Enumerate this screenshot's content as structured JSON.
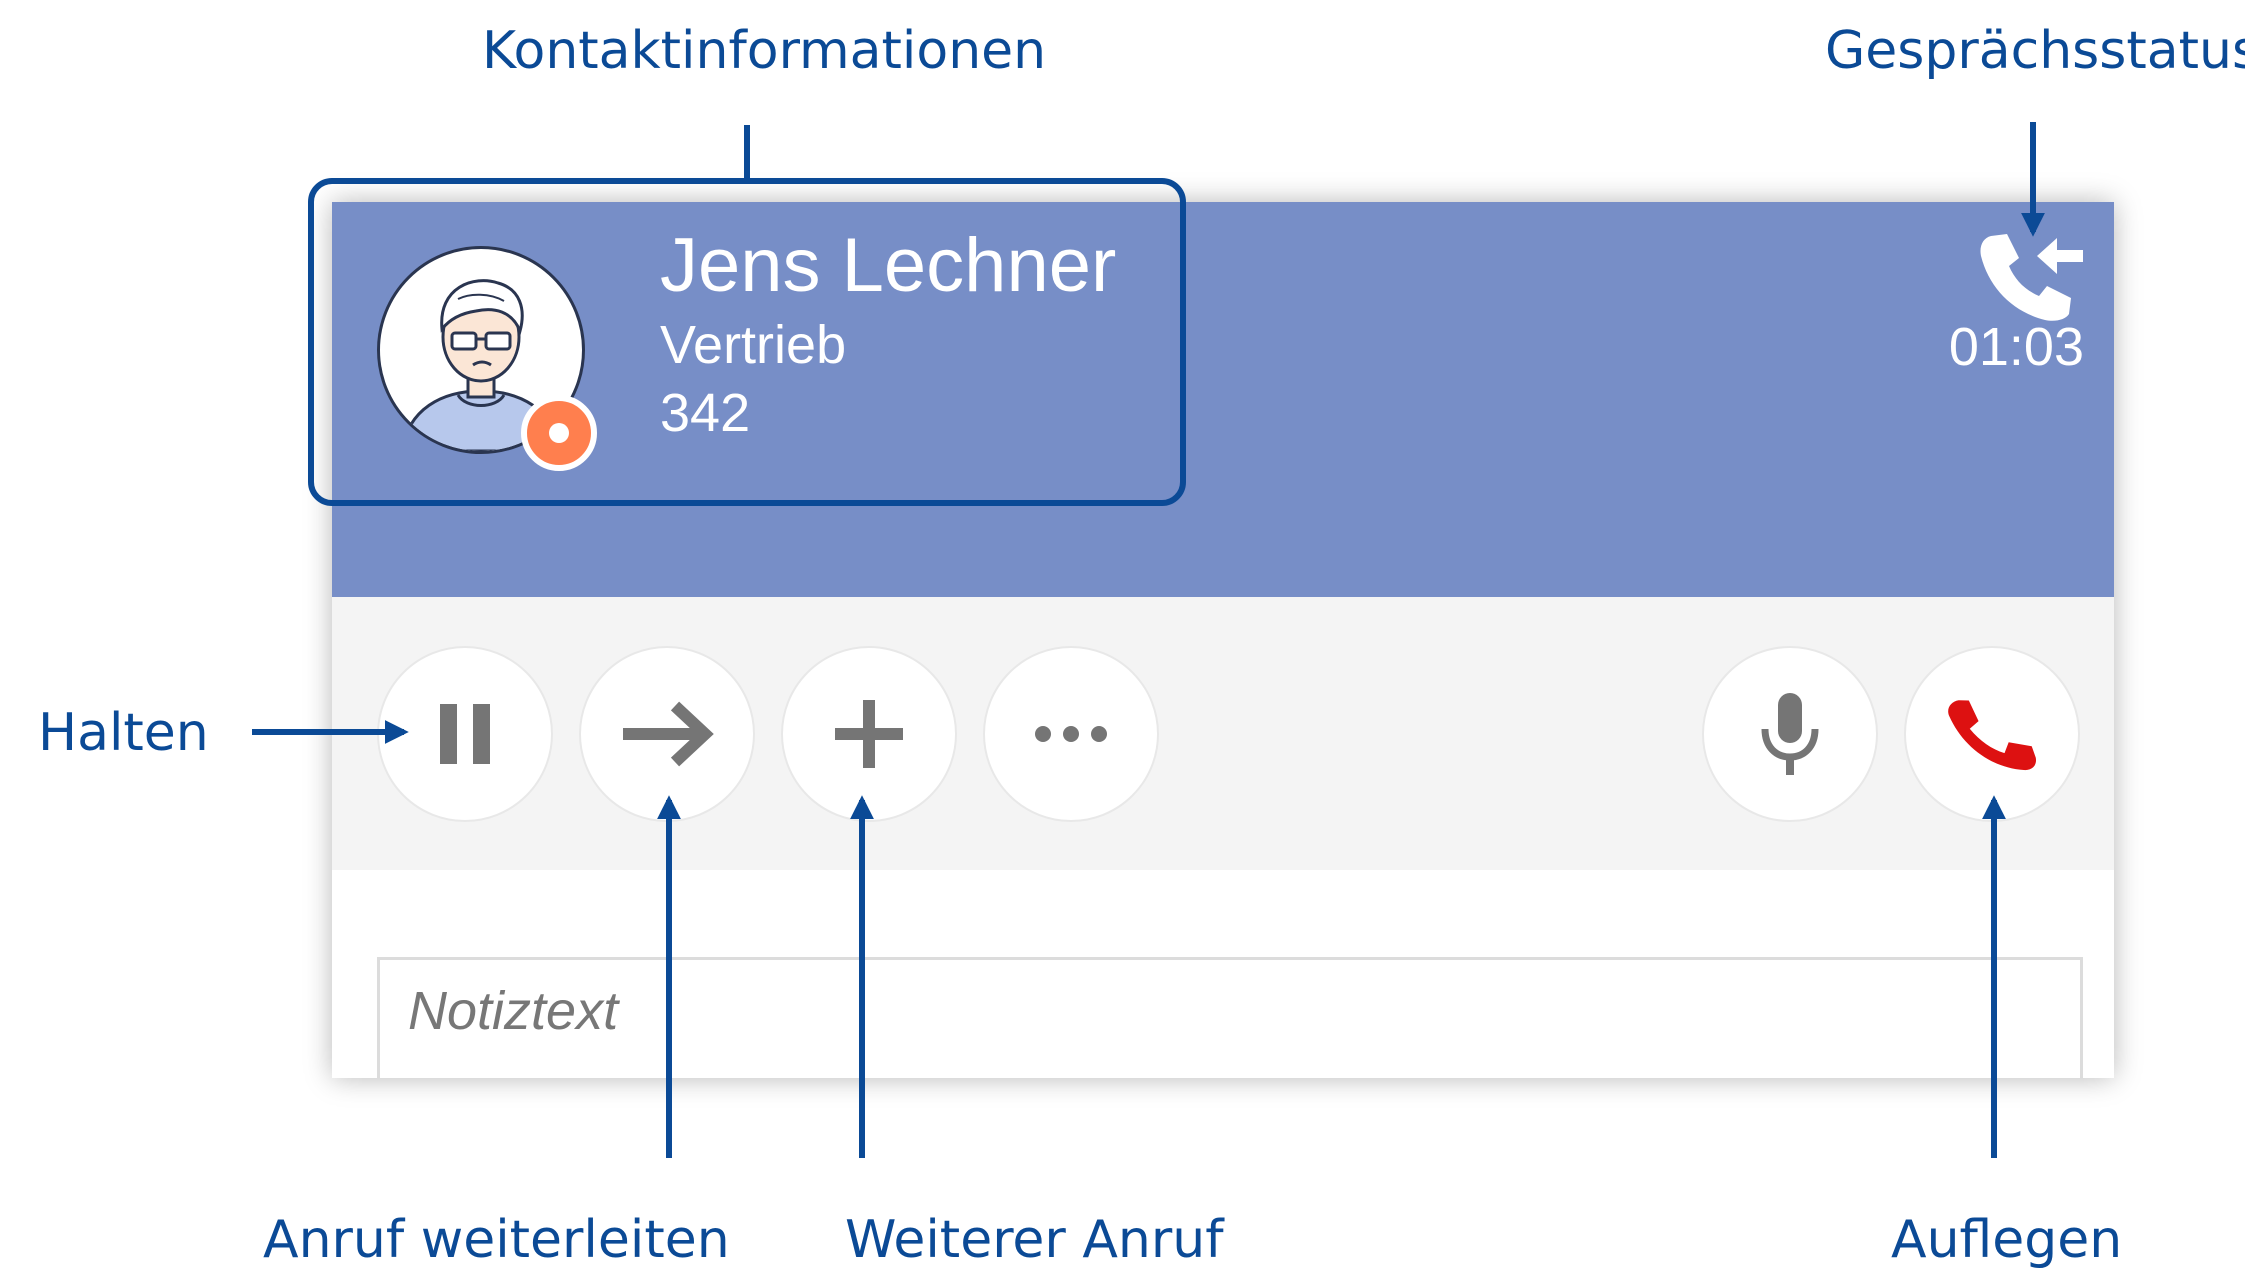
{
  "annotations": {
    "contact_info": "Kontaktinformationen",
    "call_status": "Gesprächsstatus",
    "hold": "Halten",
    "forward": "Anruf weiterleiten",
    "add_call": "Weiterer Anruf",
    "hang_up": "Auflegen"
  },
  "call": {
    "contact": {
      "name": "Jens Lechner",
      "department": "Vertrieb",
      "extension": "342",
      "presence": "busy"
    },
    "status_icon": "incoming-call-icon",
    "timer": "01:03"
  },
  "toolbar": {
    "buttons": [
      {
        "action": "hold",
        "icon": "pause-icon"
      },
      {
        "action": "forward",
        "icon": "arrow-right-icon"
      },
      {
        "action": "add-call",
        "icon": "plus-icon"
      },
      {
        "action": "more",
        "icon": "more-dots-icon"
      },
      {
        "action": "mute",
        "icon": "microphone-icon"
      },
      {
        "action": "hang-up",
        "icon": "hang-up-icon"
      }
    ]
  },
  "notes": {
    "placeholder": "Notiztext"
  },
  "colors": {
    "header": "#778ec7",
    "annotation": "#0b4a96",
    "presence_busy": "#ff7f4e",
    "hang_up": "#dd1111",
    "icon_gray": "#757575"
  }
}
